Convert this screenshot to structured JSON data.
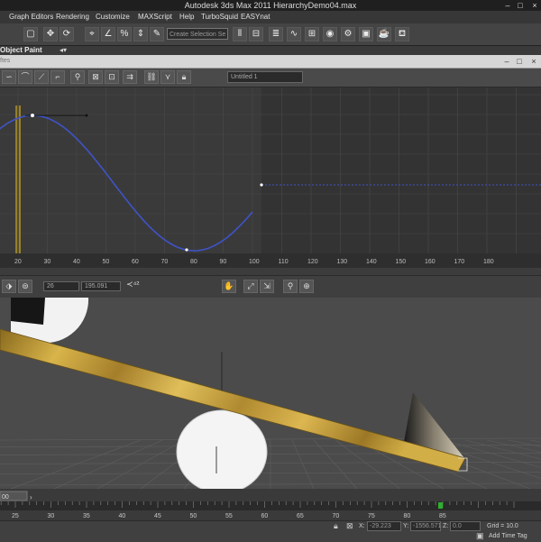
{
  "app": {
    "title": "Autodesk 3ds Max  2011      HierarchyDemo04.max"
  },
  "menu": [
    "Graph Editors",
    "Rendering",
    "Customize",
    "MAXScript",
    "Help",
    "TurboSquid",
    "EASYnat"
  ],
  "toolbar": {
    "selection_set_placeholder": "Create Selection Se"
  },
  "ribbon": {
    "label": "Object Paint"
  },
  "curve_editor": {
    "title_fragment": "ftes",
    "name_field": "Untitled 1",
    "frame_field": "26",
    "value_field": "195.091",
    "ruler_ticks": [
      20,
      30,
      40,
      50,
      60,
      70,
      80,
      90,
      100,
      110,
      120,
      130,
      140,
      150,
      160,
      170,
      180
    ],
    "current_frame": 20
  },
  "timeline": {
    "frame_start_label": "00",
    "ticks": [
      25,
      30,
      35,
      40,
      45,
      50,
      55,
      60,
      65,
      70,
      75,
      80,
      85
    ]
  },
  "status": {
    "x_label": "X:",
    "x_value": "-29.223",
    "y_label": "Y:",
    "y_value": "-1556.571",
    "z_label": "Z:",
    "z_value": "0.0",
    "grid": "Grid = 10.0",
    "add_time_tag": "Add Time Tag"
  },
  "colors": {
    "curve": "#3f53c8",
    "time_slider": "#c8a828",
    "graph_bg": "#3a3a3a",
    "plank": "#c9a23a"
  }
}
